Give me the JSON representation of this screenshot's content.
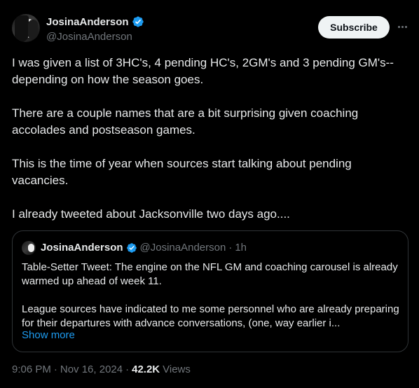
{
  "author": {
    "display_name": "JosinaAnderson",
    "handle": "@JosinaAnderson"
  },
  "subscribe_label": "Subscribe",
  "tweet_paragraphs": [
    "I was given a list of 3HC's, 4 pending HC's, 2GM's and 3 pending GM's--depending on how the season goes.",
    "There are a couple names that are a bit surprising given coaching accolades and postseason games.",
    "This is the time of year when sources start talking about pending vacancies.",
    "I already tweeted about Jacksonville two days ago...."
  ],
  "quote": {
    "display_name": "JosinaAnderson",
    "handle": "@JosinaAnderson",
    "separator": "·",
    "time": "1h",
    "paragraphs": [
      "Table-Setter Tweet: The engine on the NFL GM and coaching carousel is already warmed up ahead of week 11.",
      "League sources have indicated to me some personnel who are already preparing for their departures with advance conversations, (one, way earlier i..."
    ],
    "show_more": "Show more"
  },
  "meta": {
    "time": "9:06 PM",
    "separator": "·",
    "date": "Nov 16, 2024",
    "separator2": "·",
    "views_count": "42.2K",
    "views_label": "Views"
  },
  "colors": {
    "background": "#000000",
    "text": "#e7e9ea",
    "muted": "#71767b",
    "link": "#1d9bf0",
    "verified": "#1d9bf0"
  }
}
